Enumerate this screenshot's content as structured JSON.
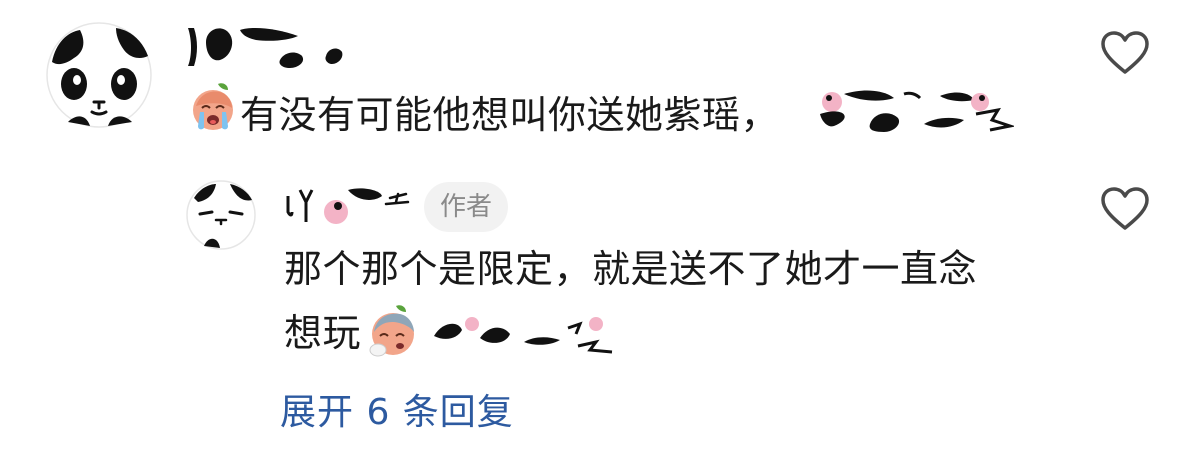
{
  "comments": [
    {
      "text": "有没有可能他想叫你送她紫瑶，"
    },
    {
      "badge": "作者",
      "text_line1": "那个那个是限定，就是送不了她才一直念",
      "text_line2": "想玩"
    }
  ],
  "expand_replies": "展开 6 条回复",
  "colors": {
    "text": "#1a1a1a",
    "link": "#2d5aa0",
    "badge_bg": "#f2f2f2",
    "badge_text": "#8a8a8a",
    "heart": "#4a4a4a"
  },
  "icons": [
    "panda-avatar-icon",
    "crying-emoji-icon",
    "fainting-emoji-icon",
    "heart-outline-icon"
  ]
}
